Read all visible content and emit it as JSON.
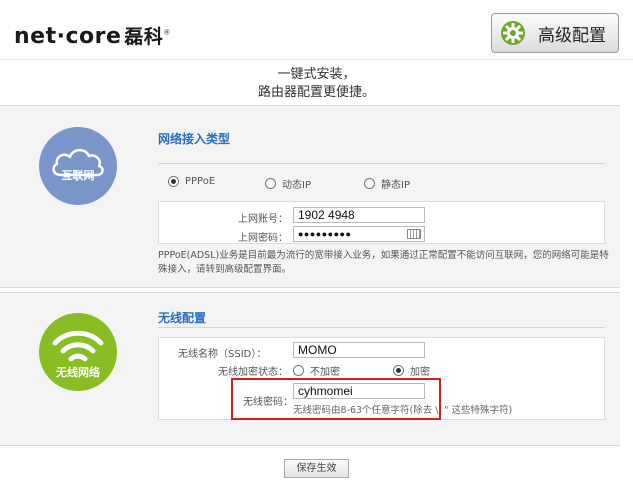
{
  "header": {
    "logo_text": "net·core",
    "logo_cn": "磊科",
    "logo_reg": "®",
    "advanced_button": "高级配置"
  },
  "slogan": {
    "line1": "一键式安装，",
    "line2": "路由器配置更便捷。"
  },
  "internet": {
    "icon_label": "互联网",
    "title": "网络接入类型",
    "options": [
      "PPPoE",
      "动态IP",
      "静态IP"
    ],
    "selected": "PPPoE",
    "account_label": "上网账号：",
    "account_value": "1902    4948",
    "password_label": "上网密码：",
    "password_value": "●●●●●●●●●",
    "note": "PPPoE(ADSL)业务是目前最为流行的宽带接入业务，如果通过正常配置不能访问互联网，您的网络可能是特殊接入，请转到高级配置界面。"
  },
  "wireless": {
    "icon_label": "无线网络",
    "title": "无线配置",
    "ssid_label": "无线名称（SSID）：",
    "ssid_value": "MOMO",
    "encrypt_label": "无线加密状态：",
    "encrypt_options": [
      "不加密",
      "加密"
    ],
    "encrypt_selected": "加密",
    "password_label": "无线密码：",
    "password_value": "cyhmomei",
    "password_hint": "无线密码由8-63个任意字符(除去 \\' \" 这些特殊字符)"
  },
  "save_button": "保存生效",
  "colors": {
    "internet_circle": "#7a95c9",
    "wireless_circle": "#88bd24",
    "section_title": "#2a6fbd",
    "highlight_box": "#d22020"
  }
}
